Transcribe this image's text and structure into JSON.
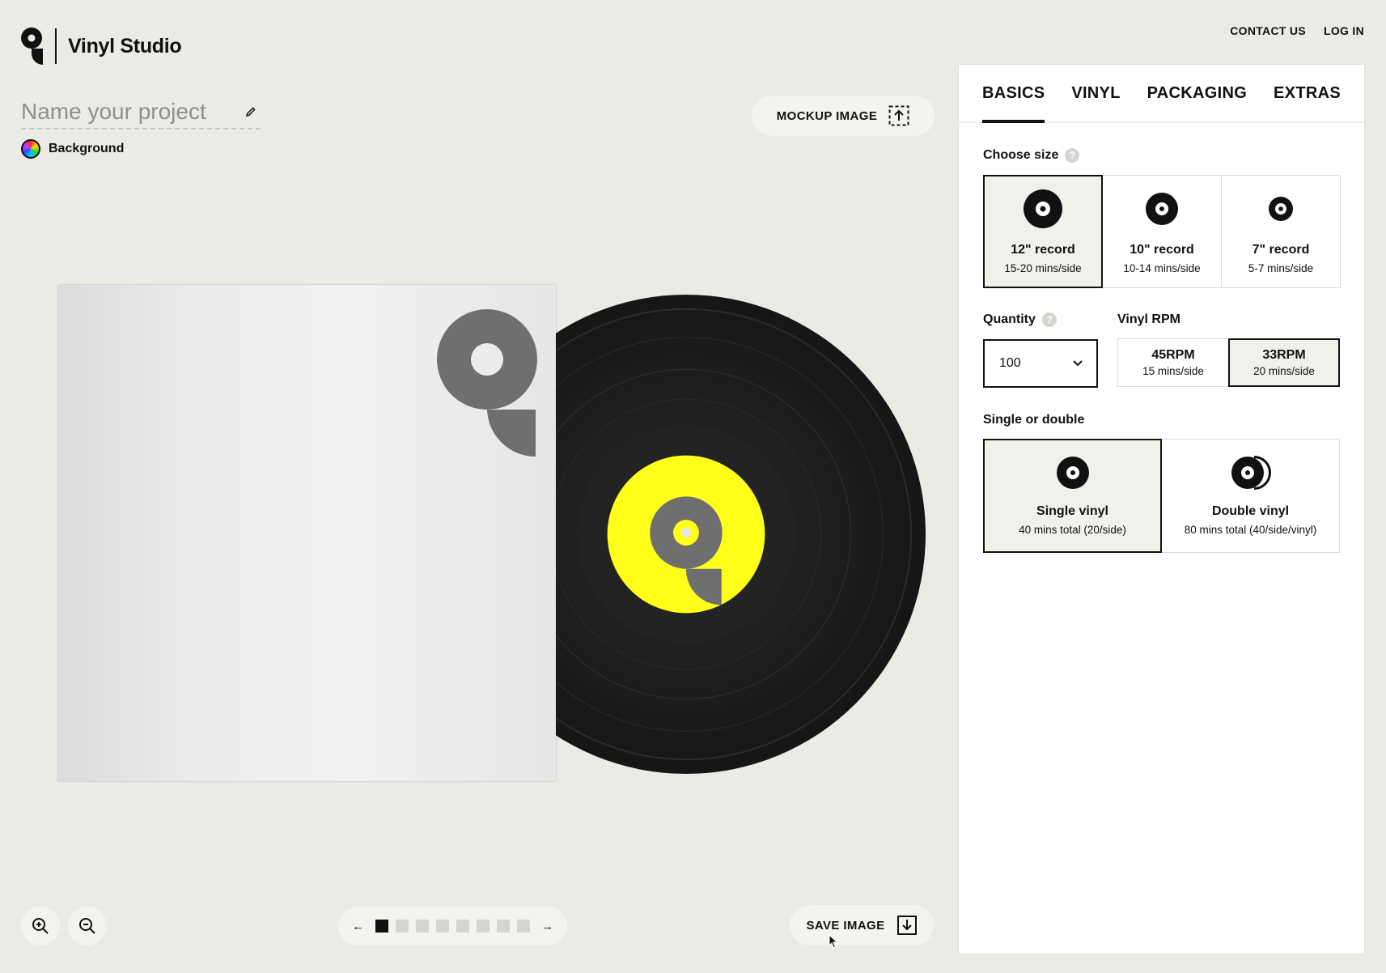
{
  "app": {
    "title": "Vinyl Studio",
    "logo_icon": "q-logo-icon"
  },
  "top_nav": {
    "contact": "CONTACT US",
    "login": "LOG IN"
  },
  "project": {
    "name_placeholder": "Name your project",
    "edit_icon": "pencil-icon"
  },
  "background": {
    "label": "Background",
    "icon": "color-wheel-icon"
  },
  "mockup": {
    "label": "MOCKUP IMAGE",
    "icon": "upload-frame-icon"
  },
  "save": {
    "label": "SAVE IMAGE",
    "icon": "download-icon"
  },
  "preview": {
    "label_color": "#ffff1a",
    "vinyl_color": "#1a1a1a",
    "logo_color": "#6f6f6f"
  },
  "pager": {
    "prev_glyph": "←",
    "next_glyph": "→",
    "pages": 8,
    "current_page": 1
  },
  "zoom": {
    "in_icon": "zoom-in-icon",
    "out_icon": "zoom-out-icon"
  },
  "panel": {
    "tabs": [
      {
        "label": "BASICS",
        "active": true
      },
      {
        "label": "VINYL",
        "active": false
      },
      {
        "label": "PACKAGING",
        "active": false
      },
      {
        "label": "EXTRAS",
        "active": false
      }
    ],
    "size": {
      "label": "Choose size",
      "help": "?",
      "options": [
        {
          "title": "12\" record",
          "subtitle": "15-20 mins/side",
          "selected": true
        },
        {
          "title": "10\" record",
          "subtitle": "10-14 mins/side",
          "selected": false
        },
        {
          "title": "7\" record",
          "subtitle": "5-7 mins/side",
          "selected": false
        }
      ]
    },
    "quantity": {
      "label": "Quantity",
      "help": "?",
      "value": "100",
      "icon": "chevron-down-icon"
    },
    "rpm": {
      "label": "Vinyl RPM",
      "options": [
        {
          "title": "45RPM",
          "subtitle": "15 mins/side",
          "selected": false
        },
        {
          "title": "33RPM",
          "subtitle": "20 mins/side",
          "selected": true
        }
      ]
    },
    "single_double": {
      "label": "Single or double",
      "options": [
        {
          "title": "Single vinyl",
          "subtitle": "40 mins total (20/side)",
          "selected": true
        },
        {
          "title": "Double vinyl",
          "subtitle": "80 mins total (40/side/vinyl)",
          "selected": false
        }
      ]
    }
  }
}
